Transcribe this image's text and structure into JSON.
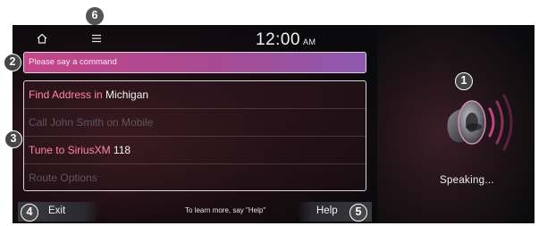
{
  "status_bar": {
    "clock_time": "12:00",
    "clock_ampm": "AM",
    "home_icon": "home-icon",
    "menu_icon": "menu-icon"
  },
  "command_prompt": {
    "text": "Please say a command"
  },
  "commands": [
    {
      "parts": [
        {
          "text": "Find Address in ",
          "style": "pink"
        },
        {
          "text": "Michigan",
          "style": "white"
        }
      ]
    },
    {
      "parts": [
        {
          "text": "Call John Smith on Mobile",
          "style": "dim"
        }
      ]
    },
    {
      "parts": [
        {
          "text": "Tune to SiriusXM ",
          "style": "pink"
        },
        {
          "text": "118",
          "style": "white"
        }
      ]
    },
    {
      "parts": [
        {
          "text": "Route Options",
          "style": "dim"
        }
      ]
    }
  ],
  "bottom_bar": {
    "exit_label": "Exit",
    "hint": "To learn more, say \"Help\"",
    "help_label": "Help"
  },
  "voice_panel": {
    "status_text": "Speaking...",
    "icon": "speaker-icon"
  },
  "callouts": {
    "c1": "1",
    "c2": "2",
    "c3": "3",
    "c4": "4",
    "c5": "5",
    "c6": "6"
  },
  "colors": {
    "accent_pink": "#ff86a4",
    "prompt_gradient_start": "#c4458a",
    "prompt_gradient_end": "#8d5ab0",
    "callout_bg": "#474749"
  }
}
